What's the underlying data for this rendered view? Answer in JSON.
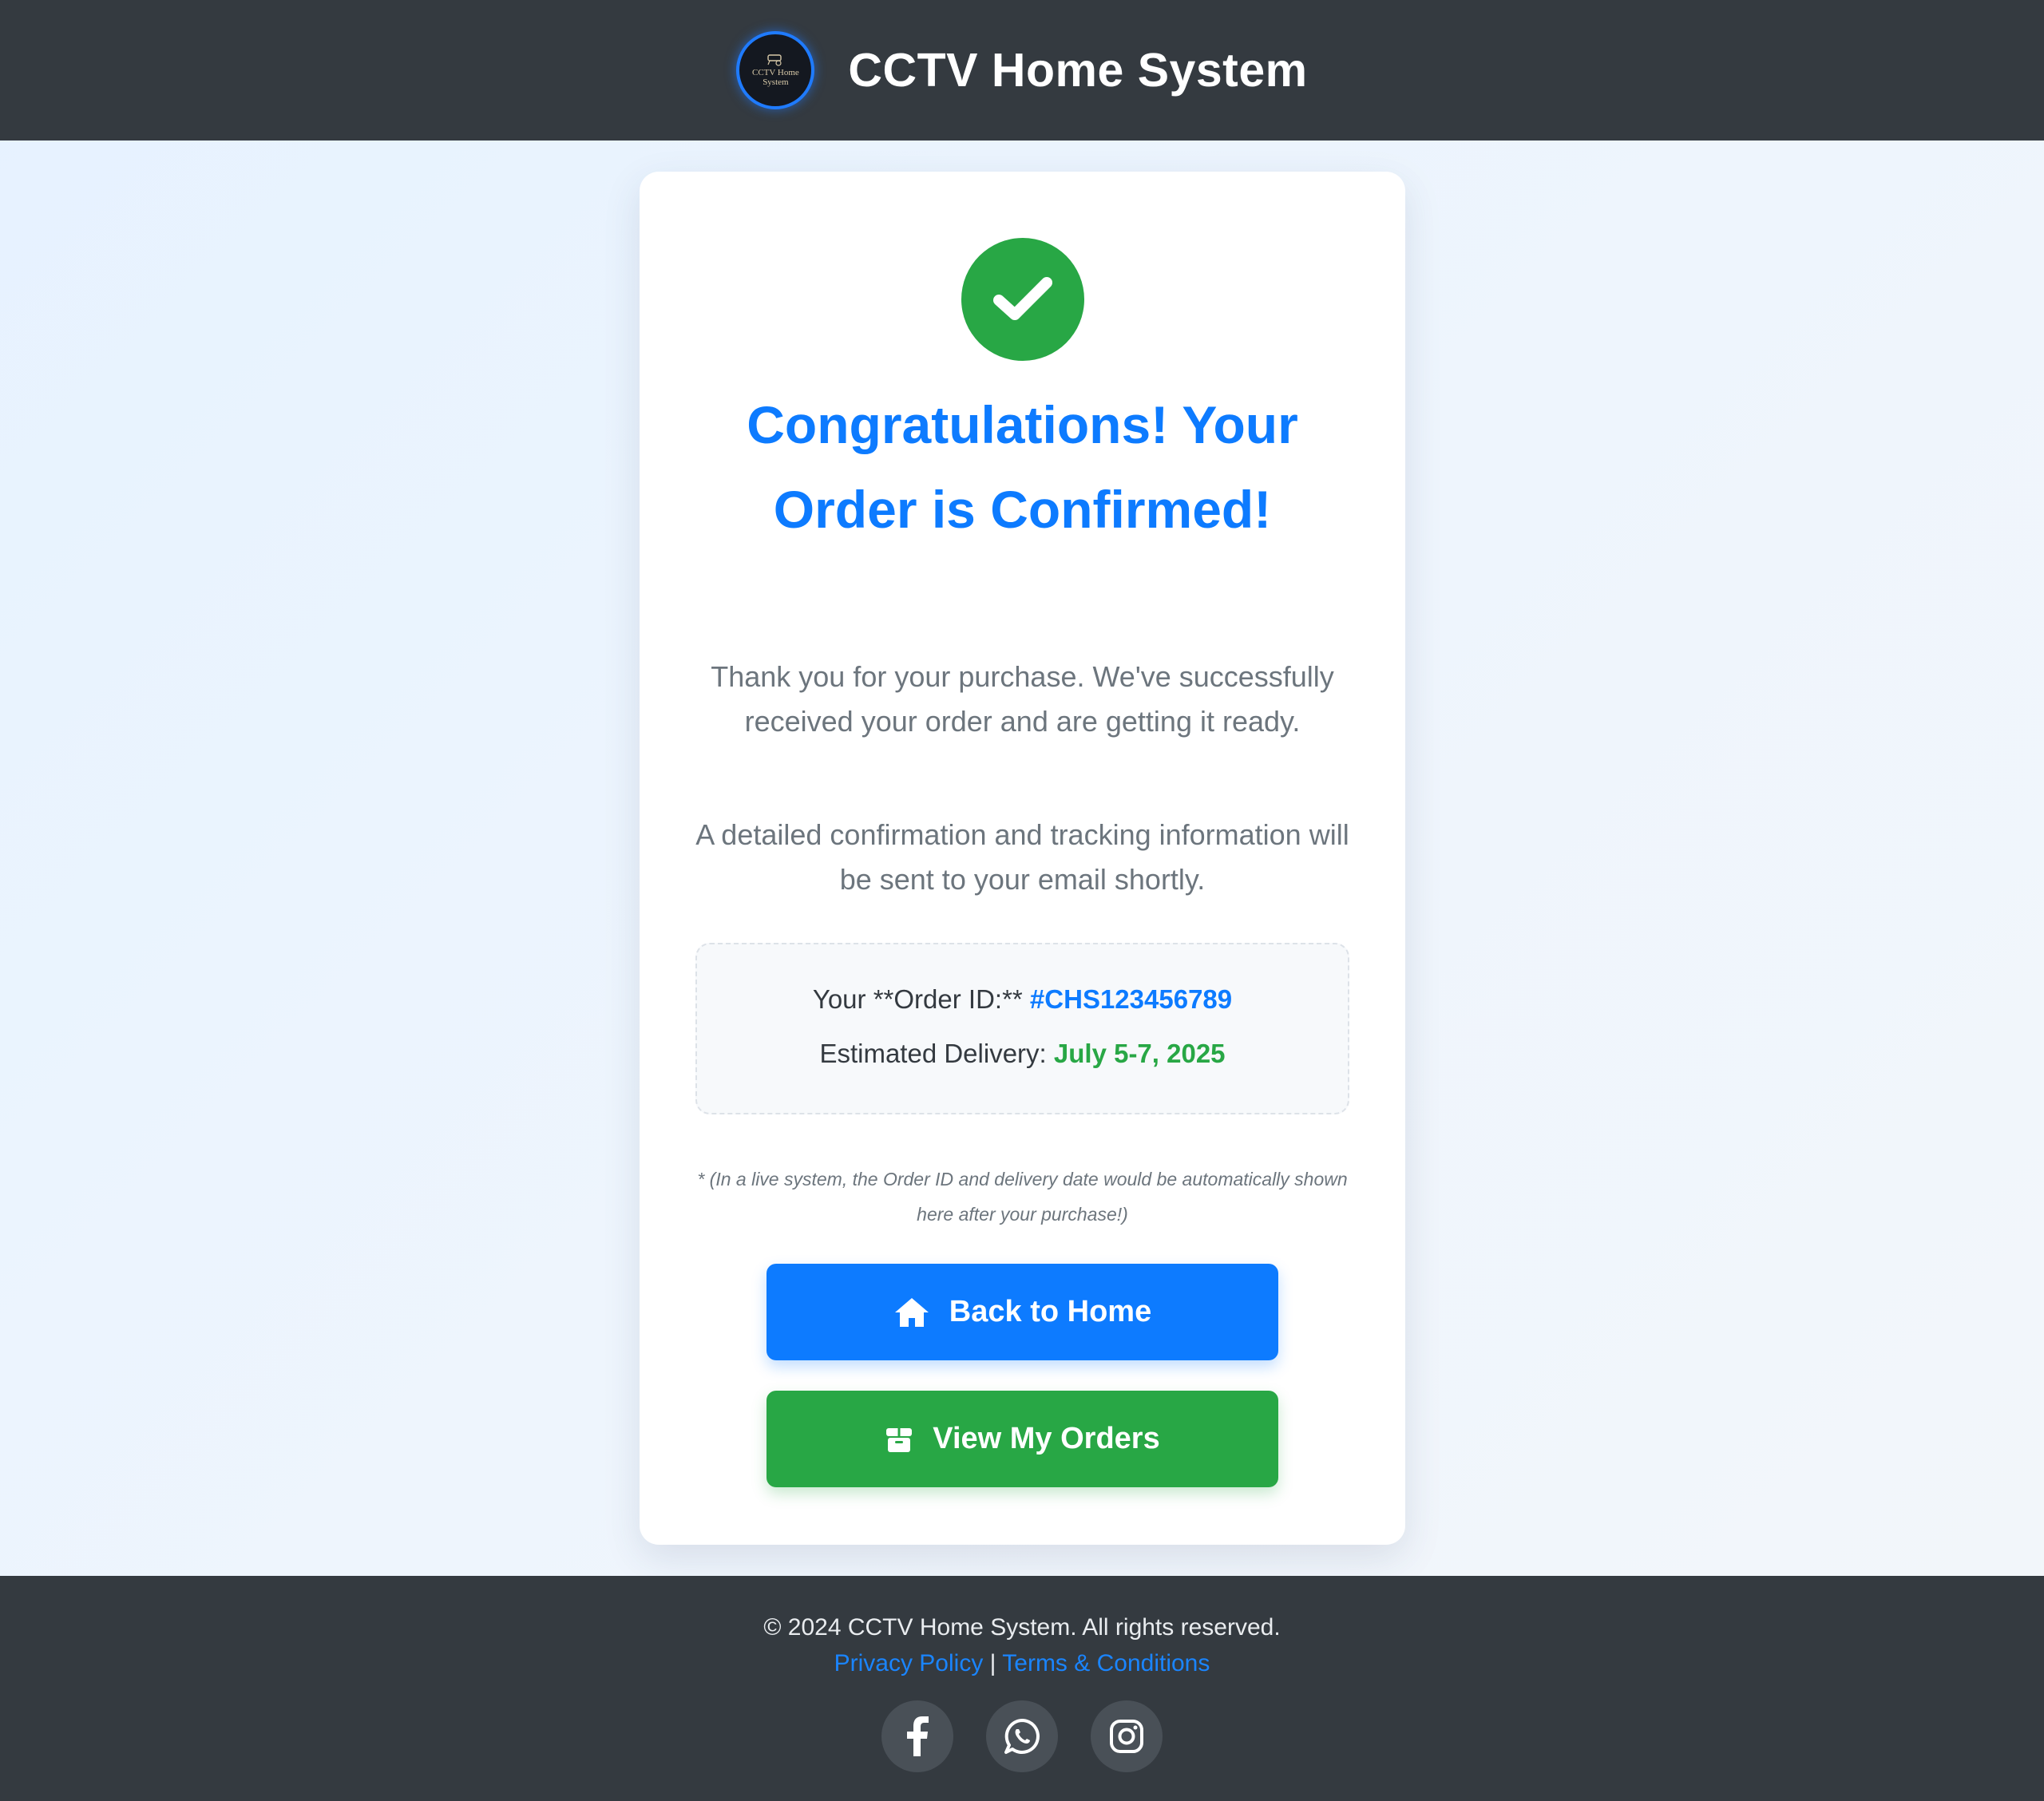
{
  "header": {
    "logo_text_line1": "CCTV Home",
    "logo_text_line2": "System",
    "title": "CCTV Home System"
  },
  "confirmation": {
    "heading": "Congratulations! Your Order is Confirmed!",
    "message": "Thank you for your purchase. We've successfully received your order and are getting it ready.",
    "email_note": "A detailed confirmation and tracking information will be sent to your email shortly.",
    "order_id_label": "Your **Order ID:**",
    "order_id": "#CHS123456789",
    "delivery_label": "Estimated Delivery:",
    "delivery_date": "July 5-7, 2025",
    "disclaimer": "* (In a live system, the Order ID and delivery date would be automatically shown here after your purchase!)"
  },
  "buttons": {
    "home_label": "Back to Home",
    "orders_label": "View My Orders"
  },
  "footer": {
    "copyright": "© 2024 CCTV Home System. All rights reserved.",
    "privacy_label": "Privacy Policy",
    "separator": "|",
    "terms_label": "Terms & Conditions",
    "social_icons": [
      "facebook-icon",
      "whatsapp-icon",
      "instagram-icon"
    ]
  },
  "colors": {
    "header_bg": "#343a40",
    "primary": "#0d7bff",
    "success": "#28a745",
    "muted": "#6c757d"
  }
}
